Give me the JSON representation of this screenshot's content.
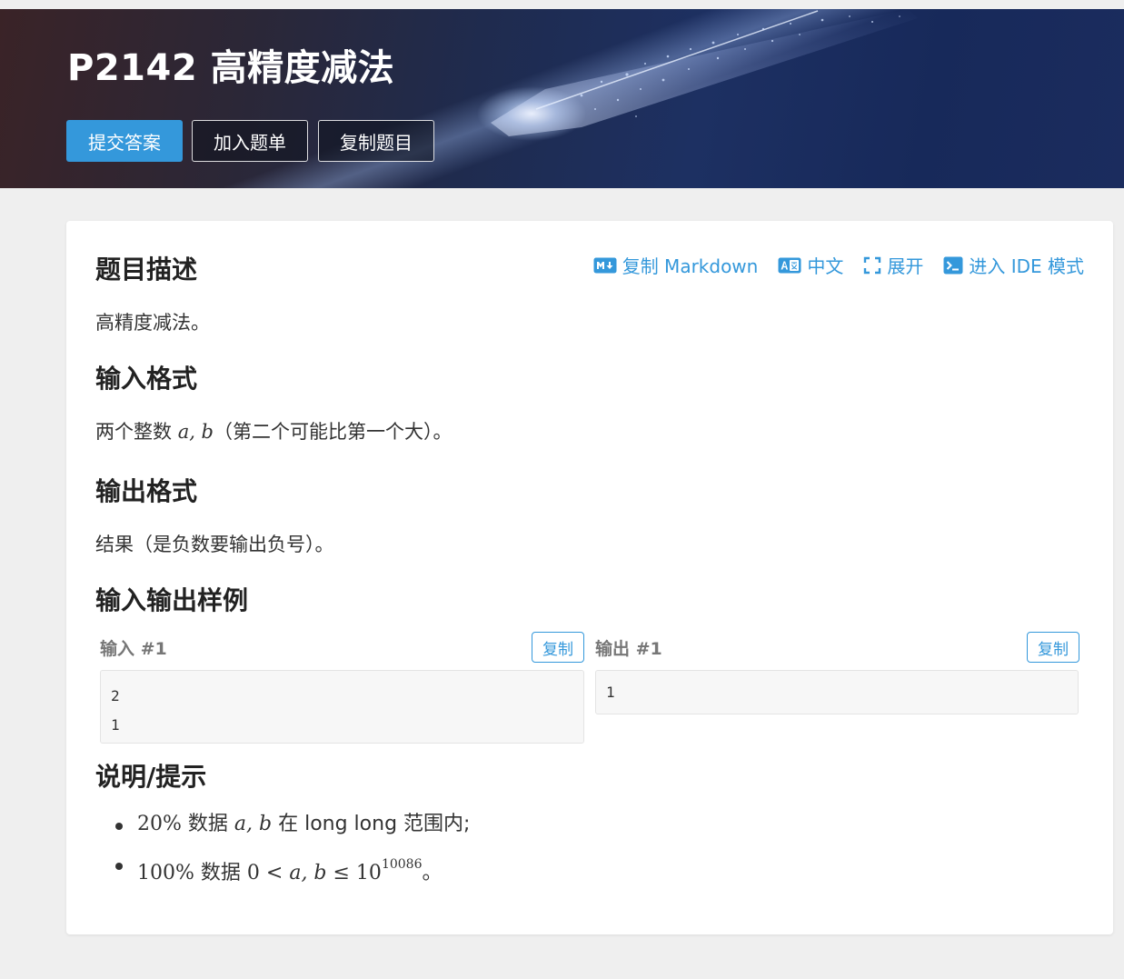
{
  "header": {
    "title": "P2142 高精度减法",
    "submit_label": "提交答案",
    "add_list_label": "加入题单",
    "copy_problem_label": "复制题目"
  },
  "toolbar": {
    "copy_markdown": "复制 Markdown",
    "language": "中文",
    "expand": "展开",
    "ide_mode": "进入 IDE 模式"
  },
  "description": {
    "heading": "题目描述",
    "text": "高精度减法。"
  },
  "input_format": {
    "heading": "输入格式",
    "text_before": "两个整数 ",
    "math": "a, b",
    "text_after": "（第二个可能比第一个大）。"
  },
  "output_format": {
    "heading": "输出格式",
    "text": "结果（是负数要输出负号）。"
  },
  "samples": {
    "heading": "输入输出样例",
    "input_label": "输入 #1",
    "output_label": "输出 #1",
    "copy_label": "复制",
    "input_lines": [
      "2",
      "1"
    ],
    "output_lines": [
      "1"
    ]
  },
  "hints": {
    "heading": "说明/提示",
    "item1": {
      "percent": "20%",
      "text1": " 数据 ",
      "math": "a, b",
      "text2": " 在 long long 范围内;"
    },
    "item2": {
      "percent": "100%",
      "text1": " 数据 ",
      "zero": "0 < ",
      "math": "a, b",
      "le": " ≤ 10",
      "exp": "10086",
      "end": "。"
    }
  },
  "colors": {
    "accent": "#3498db",
    "page_bg": "#efefef"
  }
}
